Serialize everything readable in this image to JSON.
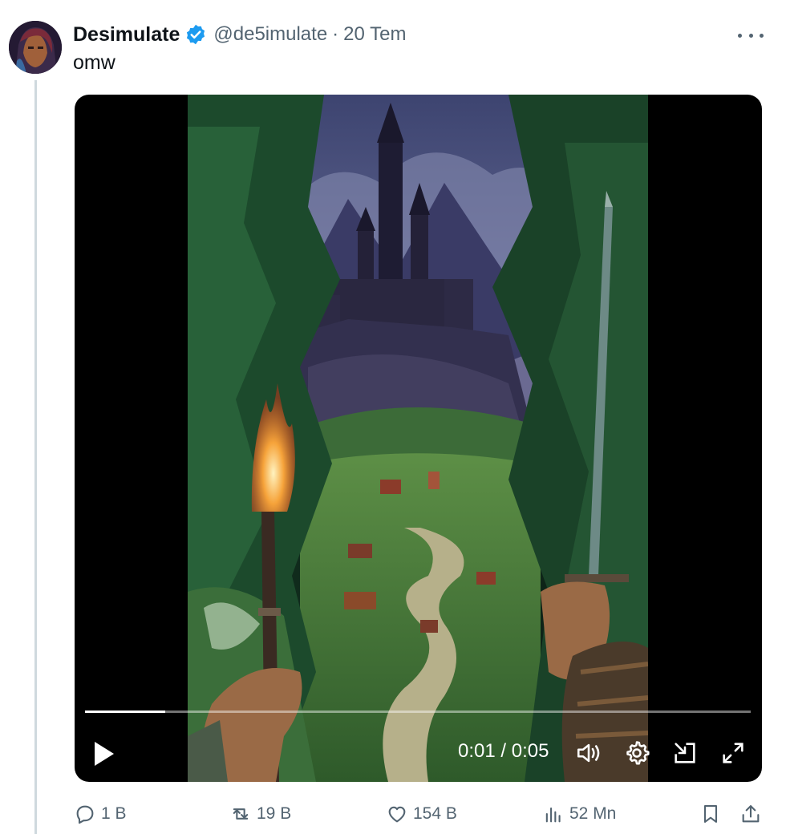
{
  "tweet": {
    "display_name": "Desimulate",
    "handle": "@de5imulate",
    "separator": "·",
    "date": "20 Tem",
    "text": "omw",
    "verified_color": "#1d9bf0"
  },
  "video": {
    "current_time": "0:01",
    "duration": "0:05",
    "time_display": "0:01 / 0:05",
    "progress_fraction": 0.12,
    "icons": [
      "play-icon",
      "volume-icon",
      "settings-icon",
      "pip-icon",
      "fullscreen-icon"
    ]
  },
  "actions": {
    "reply_count": "1 B",
    "retweet_count": "19 B",
    "like_count": "154 B",
    "views_count": "52 Mn",
    "icons": [
      "reply-icon",
      "retweet-icon",
      "like-icon",
      "views-icon",
      "bookmark-icon",
      "share-icon"
    ]
  },
  "colors": {
    "text_primary": "#0f1419",
    "text_secondary": "#536471",
    "thread_line": "#cfd9de"
  }
}
